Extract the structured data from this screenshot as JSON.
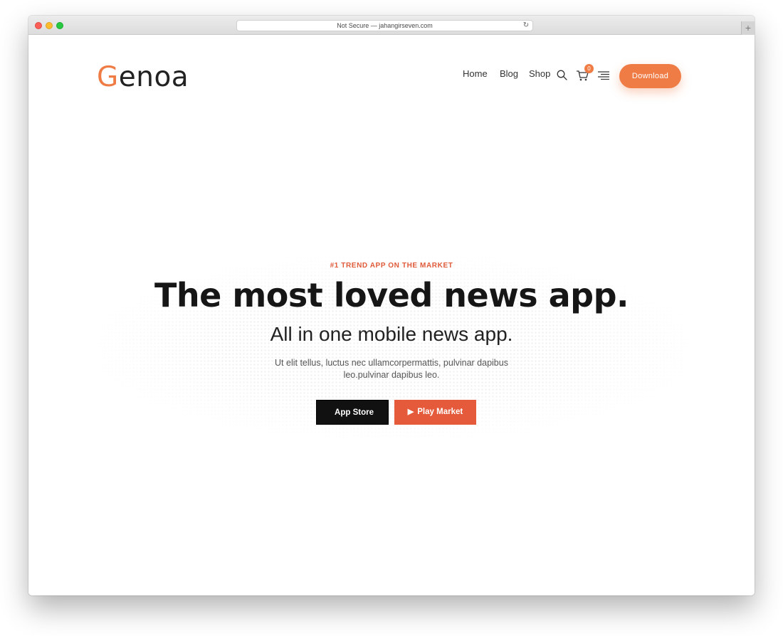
{
  "browser": {
    "url": "Not Secure — jahangirseven.com",
    "reload_icon": "reload-icon",
    "new_tab_icon": "plus-icon",
    "new_tab_symbol": "+"
  },
  "header": {
    "logo_first": "G",
    "logo_rest": "enoa",
    "nav": {
      "home": "Home",
      "blog": "Blog",
      "shop": "Shop"
    },
    "cart_count": "0",
    "download_label": "Download"
  },
  "hero": {
    "eyebrow": "#1 TREND APP ON THE MARKET",
    "headline": "The most loved news app.",
    "subheadline": "All in one mobile news app.",
    "description": "Ut elit tellus, luctus nec ullamcorpermattis, pulvinar dapibus leo.pulvinar dapibus leo.",
    "app_store_label": "App Store",
    "play_market_label": "Play Market"
  },
  "colors": {
    "accent": "#f07c45",
    "play_button": "#e45a3b",
    "app_store_button": "#111111"
  }
}
